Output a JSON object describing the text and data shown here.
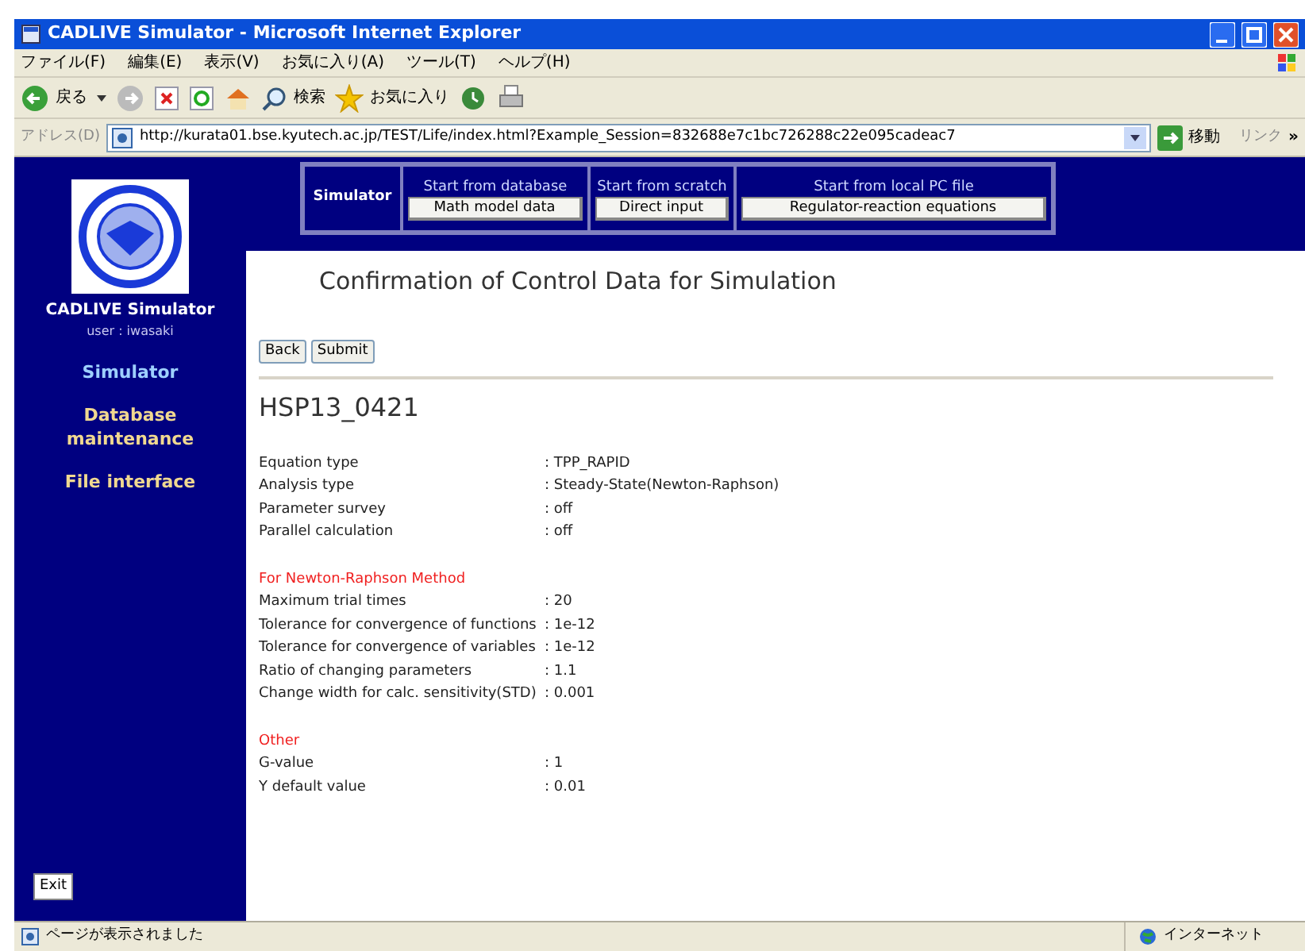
{
  "window": {
    "title": "CADLIVE Simulator - Microsoft Internet Explorer"
  },
  "menu": [
    "ファイル(F)",
    "編集(E)",
    "表示(V)",
    "お気に入り(A)",
    "ツール(T)",
    "ヘルプ(H)"
  ],
  "toolbar": {
    "back": "戻る",
    "search": "検索",
    "favorites": "お気に入り"
  },
  "address_bar": {
    "label": "アドレス(D)",
    "url": "http://kurata01.bse.kyutech.ac.jp/TEST/Life/index.html?Example_Session=832688e7c1bc726288c22e095cadeac7",
    "go": "移動",
    "links": "リンク",
    "more": "»"
  },
  "sidebar": {
    "app_name": "CADLIVE Simulator",
    "user": "user : iwasaki",
    "items": [
      {
        "label": "Simulator",
        "selected": true
      },
      {
        "label": "Database maintenance",
        "selected": false
      },
      {
        "label": "File interface",
        "selected": false
      }
    ],
    "exit": "Exit"
  },
  "top_nav": {
    "title": "Simulator",
    "groups": [
      {
        "caption": "Start from database",
        "button": "Math model data"
      },
      {
        "caption": "Start from scratch",
        "button": "Direct input"
      },
      {
        "caption": "Start from local PC file",
        "button": "Regulator-reaction equations"
      }
    ]
  },
  "page_title": "Confirmation of Control Data for Simulation",
  "buttons": [
    "Back",
    "Submit"
  ],
  "model_name": "HSP13_0421",
  "sections": [
    {
      "rows": [
        {
          "label": "Equation type",
          "value": ": TPP_RAPID"
        },
        {
          "label": "Analysis type",
          "value": ": Steady-State(Newton-Raphson)"
        },
        {
          "label": "Parameter survey",
          "value": ": off"
        },
        {
          "label": "Parallel calculation",
          "value": ": off"
        }
      ]
    },
    {
      "heading": "For Newton-Raphson Method",
      "rows": [
        {
          "label": "Maximum trial times",
          "value": ": 20"
        },
        {
          "label": "Tolerance for convergence of functions",
          "value": ": 1e-12"
        },
        {
          "label": "Tolerance for convergence of variables",
          "value": ": 1e-12"
        },
        {
          "label": "Ratio of changing parameters",
          "value": ": 1.1"
        },
        {
          "label": "Change width for calc. sensitivity(STD)",
          "value": ": 0.001"
        }
      ]
    },
    {
      "heading": "Other",
      "rows": [
        {
          "label": "G-value",
          "value": ": 1"
        },
        {
          "label": "Y default value",
          "value": ": 0.01"
        }
      ]
    }
  ],
  "status_bar": {
    "message": "ページが表示されました",
    "zone": "インターネット"
  }
}
